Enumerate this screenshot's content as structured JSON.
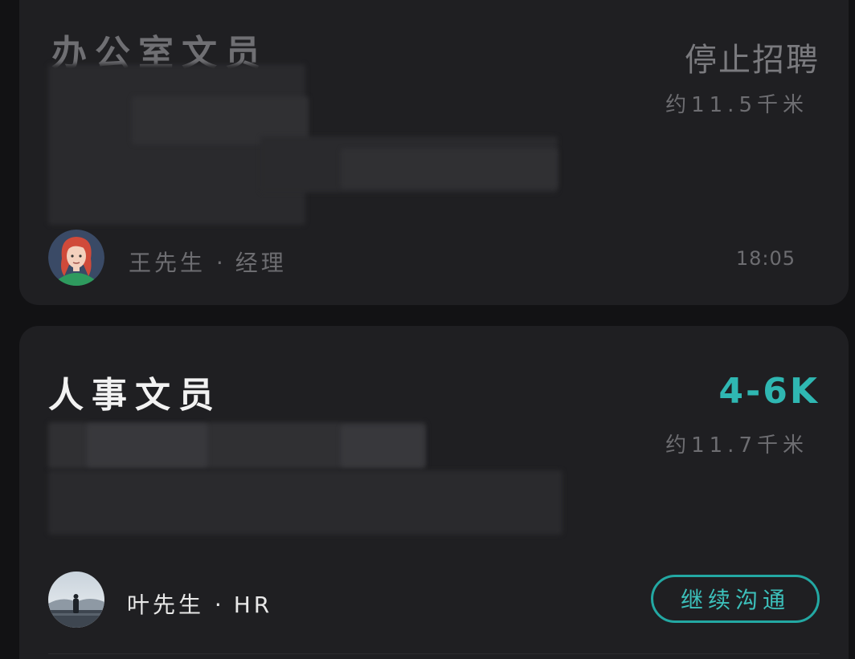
{
  "jobs": [
    {
      "title": "办公室文员",
      "status": "停止招聘",
      "distance": "约11.5千米",
      "recruiter_name": "王先生",
      "recruiter_separator": "·",
      "recruiter_role": "经理",
      "time": "18:05"
    },
    {
      "title": "人事文员",
      "salary": "4-6K",
      "distance": "约11.7千米",
      "recruiter_name": "叶先生",
      "recruiter_separator": "·",
      "recruiter_role": "HR",
      "action_label": "继续沟通"
    }
  ],
  "colors": {
    "background": "#121214",
    "card": "#1f1f22",
    "accent": "#2fb7b2",
    "muted_text": "#6d6d71"
  }
}
